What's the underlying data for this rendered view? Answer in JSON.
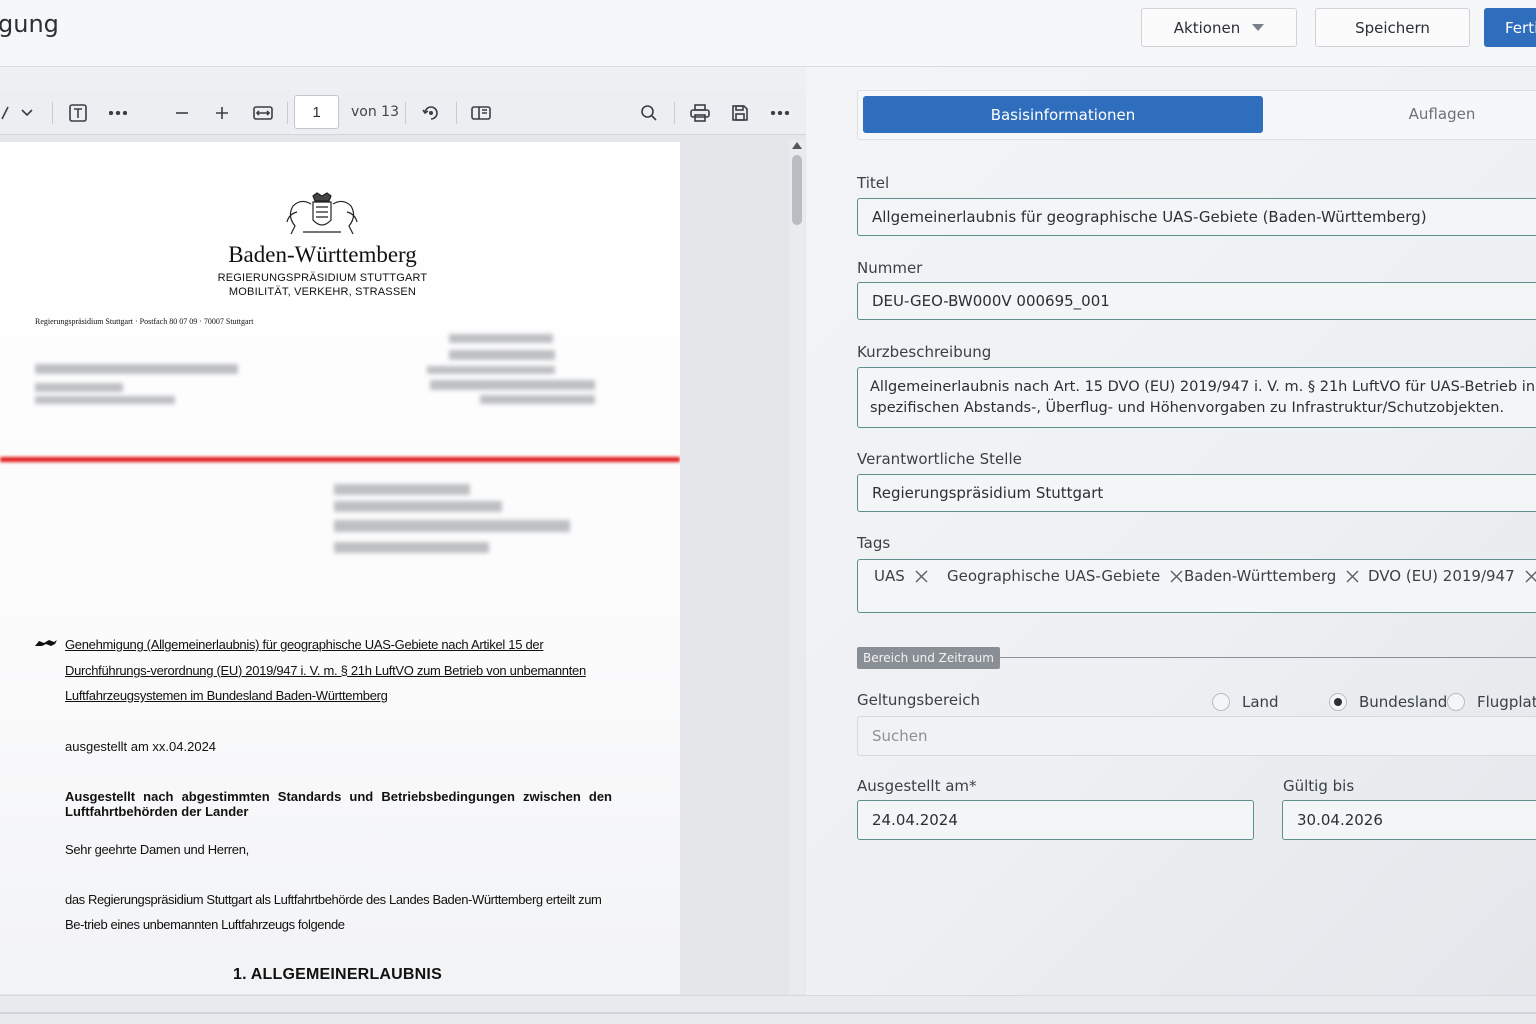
{
  "header": {
    "title": "gung",
    "actions_label": "Aktionen",
    "save_label": "Speichern",
    "finish_label": "Ferti"
  },
  "viewer": {
    "current_page": "1",
    "page_of": "von 13",
    "document": {
      "state_name": "Baden-Württemberg",
      "authority_line1": "REGIERUNGSPRÄSIDIUM STUTTGART",
      "authority_line2": "MOBILITÄT, VERKEHR, STRASSEN",
      "sender_line": "Regierungspräsidium Stuttgart · Postfach 80 07 09 · 70007 Stuttgart",
      "subject": "Genehmigung (Allgemeinerlaubnis) für geographische UAS-Gebiete nach Artikel 15 der Durchführungs-verordnung (EU) 2019/947 i. V. m. § 21h LuftVO zum Betrieb von unbemannten Luftfahrzeugsystemen im Bundesland Baden-Württemberg",
      "issued": "ausgestellt am xx.04.2024",
      "bold_heading": "Ausgestellt nach abgestimmten Standards und Betriebsbedingungen zwischen den Luftfahrtbehörden der Lander",
      "salutation": "Sehr geehrte Damen und Herren,",
      "body": "das Regierungspräsidium Stuttgart als Luftfahrtbehörde des Landes Baden-Württemberg erteilt zum Be-trieb eines unbemannten Luftfahrzeugs folgende",
      "section_heading": "1.  ALLGEMEINERLAUBNIS"
    }
  },
  "form": {
    "tabs": [
      {
        "label": "Basisinformationen",
        "active": true
      },
      {
        "label": "Auflagen",
        "active": false
      }
    ],
    "title_label": "Titel",
    "title_value": "Allgemeinerlaubnis für geographische UAS-Gebiete (Baden-Württemberg)",
    "number_label": "Nummer",
    "number_value": "DEU-GEO-BW000V 000695_001",
    "summary_label": "Kurzbeschreibung",
    "summary_line1": "Allgemeinerlaubnis nach Art. 15 DVO (EU) 2019/947 i. V. m. § 21h LuftVO für UAS-Betrieb in Baden-",
    "summary_line2": "spezifischen Abstands-, Überflug- und Höhenvorgaben zu Infrastruktur/Schutzobjekten.",
    "authority_label": "Verantwortliche Stelle",
    "authority_value": "Regierungspräsidium Stuttgart",
    "tags_label": "Tags",
    "tags": [
      "UAS",
      "Geographische UAS-Gebiete",
      "Baden-Württemberg",
      "DVO (EU) 2019/947"
    ],
    "section_label": "Bereich und Zeitraum",
    "scope_label": "Geltungsbereich",
    "scope_options": [
      {
        "label": "Land",
        "checked": false
      },
      {
        "label": "Bundesland",
        "checked": true
      },
      {
        "label": "Flugplatz",
        "checked": false
      }
    ],
    "search_placeholder": "Suchen",
    "issued_label": "Ausgestellt am*",
    "issued_value": "24.04.2024",
    "valid_label": "Gültig bis",
    "valid_value": "30.04.2026"
  },
  "colors": {
    "primary": "#2f6dbd",
    "field_border": "#5f8f8c",
    "redaction_line": "#e01616"
  }
}
